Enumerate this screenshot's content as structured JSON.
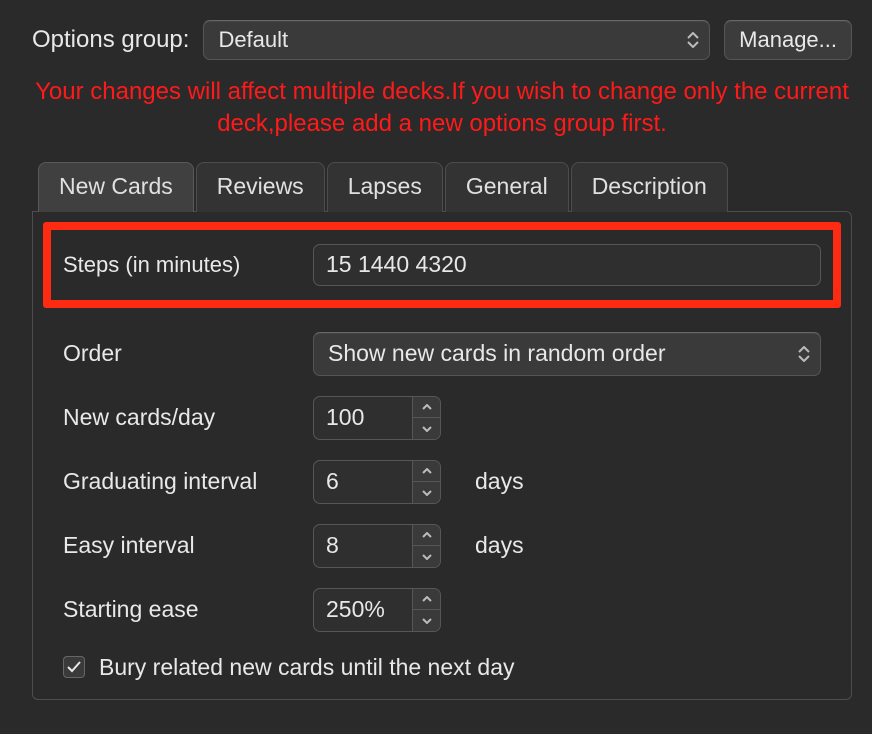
{
  "topbar": {
    "label": "Options group:",
    "selected": "Default",
    "manage": "Manage..."
  },
  "warning": "Your changes will affect multiple decks.If you wish to change only the current deck,please add a new options group first.",
  "tabs": [
    "New Cards",
    "Reviews",
    "Lapses",
    "General",
    "Description"
  ],
  "fields": {
    "steps": {
      "label": "Steps (in minutes)",
      "value": "15 1440 4320"
    },
    "order": {
      "label": "Order",
      "value": "Show new cards in random order"
    },
    "perday": {
      "label": "New cards/day",
      "value": "100"
    },
    "grad": {
      "label": "Graduating interval",
      "value": "6",
      "unit": "days"
    },
    "easy": {
      "label": "Easy interval",
      "value": "8",
      "unit": "days"
    },
    "ease": {
      "label": "Starting ease",
      "value": "250%"
    },
    "bury": {
      "label": "Bury related new cards until the next day",
      "checked": true
    }
  }
}
